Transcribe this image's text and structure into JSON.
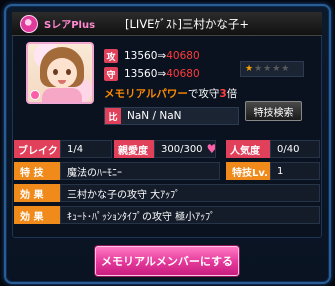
{
  "header": {
    "rarity_label": "SレアPlus",
    "card_name": "[LIVEｹﾞｽﾄ]三村かな子+"
  },
  "stats": {
    "attack": {
      "badge": "攻",
      "current": "13560",
      "arrow": "⇒",
      "max": "40680"
    },
    "defense": {
      "badge": "守",
      "current": "13560",
      "arrow": "⇒",
      "max": "40680"
    }
  },
  "rank": {
    "stars_filled": "★",
    "stars_empty": "★★★★"
  },
  "memorial": {
    "prefix": "メモリアルパワー",
    "middle": "で攻守",
    "multiplier": "3",
    "suffix": "倍"
  },
  "ratio": {
    "badge": "比",
    "value": "NaN / NaN"
  },
  "skill_search_button": "特技検索",
  "info": {
    "break_label": "ブレイク",
    "break_value": "1/4",
    "affection_label": "親愛度",
    "affection_value": "300/300",
    "popularity_label": "人気度",
    "popularity_value": "0/40",
    "skill_label": "特 技",
    "skill_value": "魔法のﾊｰﾓﾆｰ",
    "skill_level_label": "特技Lv.",
    "skill_level_value": "1",
    "effect1_label": "効 果",
    "effect1_value": "三村かな子の攻守 大ｱｯﾌﾟ",
    "effect2_label": "効 果",
    "effect2_value": "ｷｭｰﾄ･ﾊﾟｯｼｮﾝﾀｲﾌﾟの攻守 極小ｱｯﾌﾟ"
  },
  "member_button": "メモリアルメンバーにする",
  "colors": {
    "accent_pink": "#e1405b",
    "accent_orange": "#ef8a1b",
    "stat_max_red": "#ff3a3a",
    "button_pink": "#e3389a"
  }
}
